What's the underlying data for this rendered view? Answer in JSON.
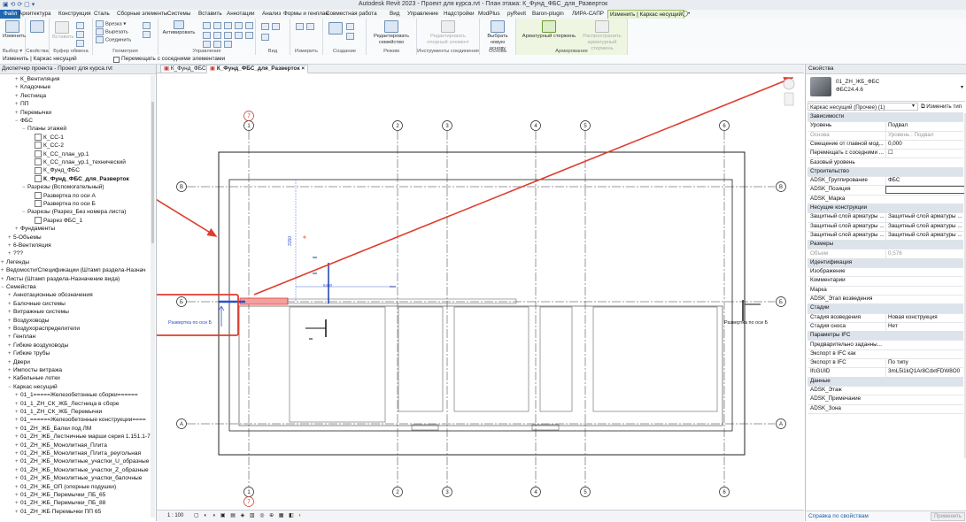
{
  "window": {
    "title": "Autodesk Revit 2023 - Проект для курса.rvt - План этажа: К_Фунд_ФБС_для_Разверток",
    "qa": "▣ ⟲ ⟳ ▢ ▾"
  },
  "menu": {
    "tabs": [
      "Файл",
      "Архитектура",
      "Конструкция",
      "Сталь",
      "Сборные элементы",
      "Системы",
      "Вставить",
      "Аннотации",
      "Анализ",
      "Формы и генплан",
      "Совместная работа",
      "Вид",
      "Управление",
      "Надстройки",
      "ModPlus",
      "pyRevit",
      "Baron-plugin",
      "ЛИРА-САПР",
      "Изменить | Каркас несущий",
      "◯•"
    ]
  },
  "ribbon": {
    "select_label": "Выбор ▾",
    "modify_label": "Изменить",
    "properties_label": "Свойства",
    "clipboard_label": "Буфер обмена",
    "insert_label": "Вставить",
    "cut_label": "Вырезать",
    "join_label": "Соединить",
    "geometry_label": "Геометрия",
    "control_label": "Управление",
    "activate_label": "Активировать",
    "view_label": "Вид",
    "measure_label": "Измерить",
    "create_label": "Создание",
    "mode_label": "Режим",
    "edit_family_label": "Редактировать семейство",
    "edit_connection_label": "Редактировать опорный элемент",
    "connection_tools_label": "Инструменты соединения",
    "select_base_label": "Выбрать новую основу",
    "base_label": "Основа",
    "rebar_label": "Арматурный стержень",
    "distribute_label": "Распространить арматурный стержень",
    "reinforcement_label": "Армирование",
    "cut_menu": "Врезка ▾"
  },
  "options_bar": {
    "context": "Изменить | Каркас несущий",
    "move_with_nearby": "Перемещать с соседними элементами"
  },
  "browser": {
    "header": "Диспетчер проекта - Проект для курса.rvt",
    "items": [
      {
        "indent": 2,
        "tw": "+",
        "label": "К_Вентиляция"
      },
      {
        "indent": 2,
        "tw": "+",
        "label": "Кладочные"
      },
      {
        "indent": 2,
        "tw": "+",
        "label": "Лестница"
      },
      {
        "indent": 2,
        "tw": "+",
        "label": "ПП"
      },
      {
        "indent": 2,
        "tw": "+",
        "label": "Перемычки"
      },
      {
        "indent": 2,
        "tw": "−",
        "label": "ФБС"
      },
      {
        "indent": 3,
        "tw": "−",
        "label": "Планы этажей"
      },
      {
        "indent": 4,
        "tw": "",
        "label": "К_СС-1",
        "icon": true
      },
      {
        "indent": 4,
        "tw": "",
        "label": "К_СС-2",
        "icon": true
      },
      {
        "indent": 4,
        "tw": "",
        "label": "К_СС_план_ур.1",
        "icon": true
      },
      {
        "indent": 4,
        "tw": "",
        "label": "К_СС_план_ур.1_технический",
        "icon": true
      },
      {
        "indent": 4,
        "tw": "",
        "label": "К_Фунд_ФБС",
        "icon": true
      },
      {
        "indent": 4,
        "tw": "",
        "label": "К_Фунд_ФБС_для_Разверток",
        "icon": true,
        "bold": true
      },
      {
        "indent": 3,
        "tw": "−",
        "label": "Разрезы (Вспомогательный)"
      },
      {
        "indent": 4,
        "tw": "",
        "label": "Развертка по оси А",
        "icon": true
      },
      {
        "indent": 4,
        "tw": "",
        "label": "Развертка по оси Б",
        "icon": true
      },
      {
        "indent": 3,
        "tw": "−",
        "label": "Разрезы (Разрез_Без номера листа)"
      },
      {
        "indent": 4,
        "tw": "",
        "label": "Разрез ФБС_1",
        "icon": true
      },
      {
        "indent": 2,
        "tw": "+",
        "label": "Фундаменты"
      },
      {
        "indent": 1,
        "tw": "+",
        "label": "5-Объемы"
      },
      {
        "indent": 1,
        "tw": "+",
        "label": "6-Вентиляция"
      },
      {
        "indent": 1,
        "tw": "+",
        "label": "???"
      },
      {
        "indent": 0,
        "tw": "+",
        "label": "Легенды"
      },
      {
        "indent": 0,
        "tw": "+",
        "label": "Ведомости/Спецификации (Штамп раздела-Назнач"
      },
      {
        "indent": 0,
        "tw": "+",
        "label": "Листы (Штамп раздела-Назначение вида)"
      },
      {
        "indent": 0,
        "tw": "−",
        "label": "Семейства"
      },
      {
        "indent": 1,
        "tw": "+",
        "label": "Аннотационные обозначения"
      },
      {
        "indent": 1,
        "tw": "+",
        "label": "Балочные системы"
      },
      {
        "indent": 1,
        "tw": "+",
        "label": "Витражные системы"
      },
      {
        "indent": 1,
        "tw": "+",
        "label": "Воздуховоды"
      },
      {
        "indent": 1,
        "tw": "+",
        "label": "Воздухораспределители"
      },
      {
        "indent": 1,
        "tw": "+",
        "label": "Генплан"
      },
      {
        "indent": 1,
        "tw": "+",
        "label": "Гибкие воздуховоды"
      },
      {
        "indent": 1,
        "tw": "+",
        "label": "Гибкие трубы"
      },
      {
        "indent": 1,
        "tw": "+",
        "label": "Двери"
      },
      {
        "indent": 1,
        "tw": "+",
        "label": "Импосты витража"
      },
      {
        "indent": 1,
        "tw": "+",
        "label": "Кабельные лотки"
      },
      {
        "indent": 1,
        "tw": "−",
        "label": "Каркас несущий"
      },
      {
        "indent": 2,
        "tw": "+",
        "label": "01_1=====Железобетонные сборки======"
      },
      {
        "indent": 2,
        "tw": "+",
        "label": "01_1_ZH_СК_ЖБ_Лестница в сборе"
      },
      {
        "indent": 2,
        "tw": "+",
        "label": "01_1_ZH_СК_ЖБ_Перемычки"
      },
      {
        "indent": 2,
        "tw": "+",
        "label": "01_======Железобетонные конструкции===="
      },
      {
        "indent": 2,
        "tw": "+",
        "label": "01_ZH_ЖБ_Балки под ЛМ"
      },
      {
        "indent": 2,
        "tw": "+",
        "label": "01_ZH_ЖБ_Лестничные марши серия 1.151.1-7 в"
      },
      {
        "indent": 2,
        "tw": "+",
        "label": "01_ZH_ЖБ_Монолитная_Плита"
      },
      {
        "indent": 2,
        "tw": "+",
        "label": "01_ZH_ЖБ_Монолитная_Плита_реугольная"
      },
      {
        "indent": 2,
        "tw": "+",
        "label": "01_ZH_ЖБ_Монолитные_участки_U_образные"
      },
      {
        "indent": 2,
        "tw": "+",
        "label": "01_ZH_ЖБ_Монолитные_участки_Z_образные"
      },
      {
        "indent": 2,
        "tw": "+",
        "label": "01_ZH_ЖБ_Монолитные_участки_балочные"
      },
      {
        "indent": 2,
        "tw": "+",
        "label": "01_ZH_ЖБ_ОП (опорные подушки)"
      },
      {
        "indent": 2,
        "tw": "+",
        "label": "01_ZH_ЖБ_Перемычки_ПБ_65"
      },
      {
        "indent": 2,
        "tw": "+",
        "label": "01_ZH_ЖБ_Перемычки_ПБ_88"
      },
      {
        "indent": 2,
        "tw": "+",
        "label": "01_ZH_ЖБ Перемычки ПП 65"
      }
    ]
  },
  "view_tabs": [
    {
      "label": "К_Фунд_ФБС",
      "active": false
    },
    {
      "label": "К_Фунд_ФБС_для_Разверток",
      "active": true
    }
  ],
  "canvas": {
    "grid_numbers": [
      "1",
      "2",
      "3",
      "4",
      "5",
      "6"
    ],
    "grid_letters": [
      "В",
      "Б",
      "А"
    ],
    "seven": "7",
    "section_left": "Развертка по оси Б",
    "section_right": "Развертка по оси Б",
    "dim_vertical": "3150",
    "dim_horizontal": "6490",
    "accent_red": "#e03c2e",
    "highlight_blue": "#2a4fd0"
  },
  "status": {
    "scale": "1 : 100",
    "icons": "▢ ◐ ◑ ▣ ▤ ◈ ▥ ◎ ⊕ ▦ ◧ ‹"
  },
  "properties": {
    "header": "Свойства",
    "type_name": "01_ZH_ЖБ_ФБС",
    "type_sub": "ФБС24.4.6",
    "filter": "Каркас несущий (Прочее) (1)",
    "edit_type": "Изменить тип",
    "help": "Справка по свойствам",
    "apply": "Применить",
    "rows": [
      {
        "cat": true,
        "key": "Зависимости"
      },
      {
        "key": "Уровень",
        "value": "Подвал"
      },
      {
        "key": "Основа",
        "value": "Уровень : Подвал",
        "dim": true
      },
      {
        "key": "Смещение от главной мод...",
        "value": "0,000"
      },
      {
        "key": "Перемещать с соседними ...",
        "value": "☐"
      },
      {
        "key": "Базовый уровень",
        "value": ""
      },
      {
        "cat": true,
        "key": "Строительство"
      },
      {
        "key": "ADSK_Группирование",
        "value": "ФБС"
      },
      {
        "key": "ADSK_Позиция",
        "value": "",
        "box": true
      },
      {
        "key": "ADSK_Марка",
        "value": ""
      },
      {
        "cat": true,
        "key": "Несущие конструкции"
      },
      {
        "key": "Защитный слой арматуры ...",
        "value": "Защитный слой арматуры ..."
      },
      {
        "key": "Защитный слой арматуры ...",
        "value": "Защитный слой арматуры ..."
      },
      {
        "key": "Защитный слой арматуры ...",
        "value": "Защитный слой арматуры ..."
      },
      {
        "cat": true,
        "key": "Размеры"
      },
      {
        "key": "Объем",
        "value": "0,576",
        "dim": true
      },
      {
        "cat": true,
        "key": "Идентификация"
      },
      {
        "key": "Изображение",
        "value": ""
      },
      {
        "key": "Комментарии",
        "value": ""
      },
      {
        "key": "Марка",
        "value": ""
      },
      {
        "key": "ADSK_Этап возведения",
        "value": ""
      },
      {
        "cat": true,
        "key": "Стадии"
      },
      {
        "key": "Стадия возведения",
        "value": "Новая конструкция"
      },
      {
        "key": "Стадия сноса",
        "value": "Нет"
      },
      {
        "cat": true,
        "key": "Параметры IFC"
      },
      {
        "key": "Предварительно заданны...",
        "value": ""
      },
      {
        "key": "Экспорт в IFC как",
        "value": ""
      },
      {
        "key": "Экспорт в IFC",
        "value": "По типу"
      },
      {
        "key": "IfcGUID",
        "value": "3mL5i1kQ1Ar8CdxtFDW8O0"
      },
      {
        "cat": true,
        "key": "Данные"
      },
      {
        "key": "ADSK_Этаж",
        "value": ""
      },
      {
        "key": "ADSK_Примечание",
        "value": ""
      },
      {
        "key": "ADSK_Зона",
        "value": ""
      }
    ]
  }
}
